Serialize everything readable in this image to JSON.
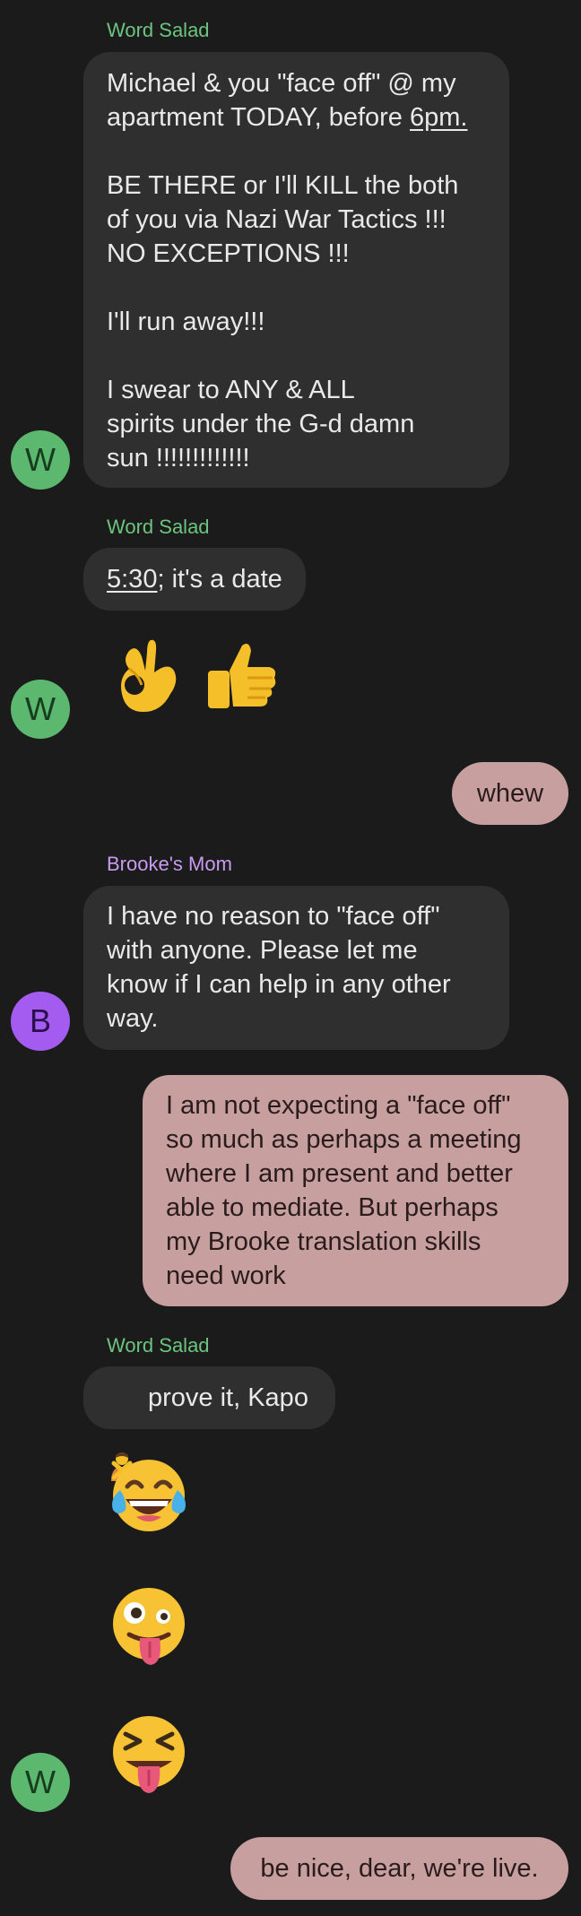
{
  "colors": {
    "background": "#1b1b1b",
    "incoming_bubble": "#2f2f2f",
    "outgoing_bubble": "#c79f9f",
    "word_salad_name": "#6cc57e",
    "brookes_mom_name": "#c89bf2",
    "avatar_w": "#5cb86e",
    "avatar_b": "#a45bf0"
  },
  "conversation": {
    "group1": {
      "sender": "Word Salad",
      "msg1": {
        "lines": [
          "Michael & you \"face off\" @ my",
          "apartment TODAY, before ",
          "6pm.",
          "BE THERE or I'll KILL the both",
          "of you via Nazi War Tactics !!!",
          "NO EXCEPTIONS !!!",
          "I'll run away!!!",
          "I swear to ANY & ALL",
          "spirits under the G-d damn",
          "sun !!!!!!!!!!!!!"
        ]
      },
      "avatar_letter": "W"
    },
    "group2": {
      "sender": "Word Salad",
      "msg2_link": "5:30",
      "msg2_rest": "; it's a date",
      "emoji_names": [
        "ok-hand-emoji",
        "thumbs-up-emoji"
      ],
      "avatar_letter": "W"
    },
    "out1": "whew",
    "group3": {
      "sender": "Brooke's Mom",
      "text": "I have no reason to \"face off\"\nwith anyone. Please let me\nknow if I can help in any other\nway.",
      "avatar_letter": "B"
    },
    "out2": "I am not expecting a \"face off\"\nso much as perhaps a meeting\nwhere I am present and better\nable to mediate. But perhaps\nmy Brooke translation skills\nneed work",
    "group4": {
      "sender": "Word Salad",
      "text": "prove it, Kapo",
      "emoji_names": [
        "tears-of-joy-emoji",
        "zany-face-emoji",
        "squinting-tongue-emoji"
      ],
      "avatar_letter": "W"
    },
    "out3": "be nice, dear, we're live."
  }
}
